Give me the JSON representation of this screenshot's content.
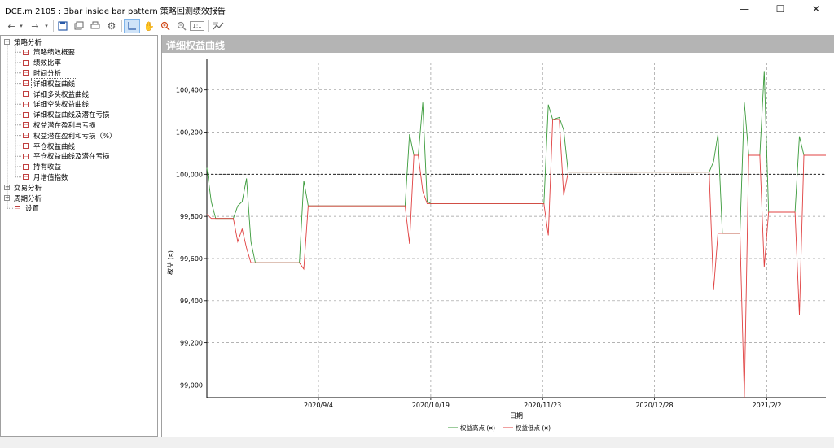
{
  "window": {
    "title": "DCE.m 2105 : 3bar inside bar pattern 策略回测绩效报告",
    "minimize_glyph": "—",
    "maximize_glyph": "☐",
    "close_glyph": "✕"
  },
  "toolbar": {
    "icons": [
      "back-icon",
      "dropdown-icon",
      "forward-icon",
      "dropdown-icon",
      "save-icon",
      "copy-icon",
      "print-icon",
      "settings-icon",
      "crosshair-icon",
      "pan-icon",
      "zoom-in-icon",
      "zoom-out-icon",
      "zoom-reset-icon",
      "chart-export-icon"
    ],
    "zoom_reset_label": "1:1"
  },
  "tree": {
    "groups": [
      {
        "label": "策略分析",
        "expanded": true,
        "items": [
          "策略绩效概要",
          "绩效比率",
          "时间分析",
          "详细权益曲线",
          "详细多头权益曲线",
          "详细空头权益曲线",
          "详细权益曲线及潜在亏损",
          "权益潜在盈利与亏损",
          "权益潜在盈利和亏损（%）",
          "平仓权益曲线",
          "平仓权益曲线及潜在亏损",
          "持有收益",
          "月增值指数"
        ],
        "selected_index": 3
      },
      {
        "label": "交易分析",
        "expanded": false,
        "items": []
      },
      {
        "label": "周期分析",
        "expanded": false,
        "items": []
      }
    ],
    "settings_label": "设置"
  },
  "panel": {
    "title": "详细权益曲线"
  },
  "chart_data": {
    "type": "line",
    "xlabel": "日期",
    "ylabel": "权益 (¤)",
    "x_ticks": [
      "2020/9/4",
      "2020/10/19",
      "2020/11/23",
      "2020/12/28",
      "2021/2/2"
    ],
    "y_ticks": [
      "99,000",
      "99,200",
      "99,400",
      "99,600",
      "99,800",
      "100,000",
      "100,200",
      "100,400"
    ],
    "ylim": [
      98940,
      100530
    ],
    "reference_line": 100000,
    "grid": true,
    "legend_position": "bottom-center",
    "series": [
      {
        "name": "权益高点 (¤)",
        "color": "#3a9a3a",
        "points": [
          [
            0,
            100030
          ],
          [
            2,
            99870
          ],
          [
            4,
            99790
          ],
          [
            12,
            99790
          ],
          [
            14,
            99850
          ],
          [
            16,
            99870
          ],
          [
            18,
            99980
          ],
          [
            20,
            99680
          ],
          [
            22,
            99580
          ],
          [
            42,
            99580
          ],
          [
            44,
            99970
          ],
          [
            46,
            99850
          ],
          [
            90,
            99850
          ],
          [
            92,
            100190
          ],
          [
            94,
            100090
          ],
          [
            96,
            100090
          ],
          [
            98,
            100340
          ],
          [
            100,
            99870
          ],
          [
            102,
            99860
          ],
          [
            153,
            99860
          ],
          [
            155,
            100330
          ],
          [
            157,
            100260
          ],
          [
            160,
            100270
          ],
          [
            162,
            100210
          ],
          [
            164,
            100010
          ],
          [
            228,
            100010
          ],
          [
            230,
            100060
          ],
          [
            232,
            100190
          ],
          [
            234,
            99720
          ],
          [
            242,
            99720
          ],
          [
            244,
            100340
          ],
          [
            246,
            100090
          ],
          [
            251,
            100090
          ],
          [
            253,
            100490
          ],
          [
            255,
            99820
          ],
          [
            267,
            99820
          ],
          [
            269,
            100180
          ],
          [
            271,
            100090
          ],
          [
            281,
            100090
          ]
        ]
      },
      {
        "name": "权益低点 (¤)",
        "color": "#e04040",
        "points": [
          [
            0,
            99810
          ],
          [
            2,
            99790
          ],
          [
            12,
            99790
          ],
          [
            14,
            99680
          ],
          [
            16,
            99740
          ],
          [
            18,
            99650
          ],
          [
            20,
            99580
          ],
          [
            42,
            99580
          ],
          [
            44,
            99550
          ],
          [
            46,
            99850
          ],
          [
            90,
            99850
          ],
          [
            92,
            99670
          ],
          [
            94,
            100090
          ],
          [
            96,
            100090
          ],
          [
            98,
            99920
          ],
          [
            100,
            99860
          ],
          [
            153,
            99860
          ],
          [
            155,
            99710
          ],
          [
            157,
            100260
          ],
          [
            160,
            100260
          ],
          [
            162,
            99900
          ],
          [
            164,
            100010
          ],
          [
            228,
            100010
          ],
          [
            230,
            99450
          ],
          [
            232,
            99720
          ],
          [
            242,
            99720
          ],
          [
            244,
            98940
          ],
          [
            246,
            100090
          ],
          [
            251,
            100090
          ],
          [
            253,
            99560
          ],
          [
            255,
            99820
          ],
          [
            267,
            99820
          ],
          [
            269,
            99330
          ],
          [
            271,
            100090
          ],
          [
            281,
            100090
          ]
        ]
      }
    ]
  }
}
